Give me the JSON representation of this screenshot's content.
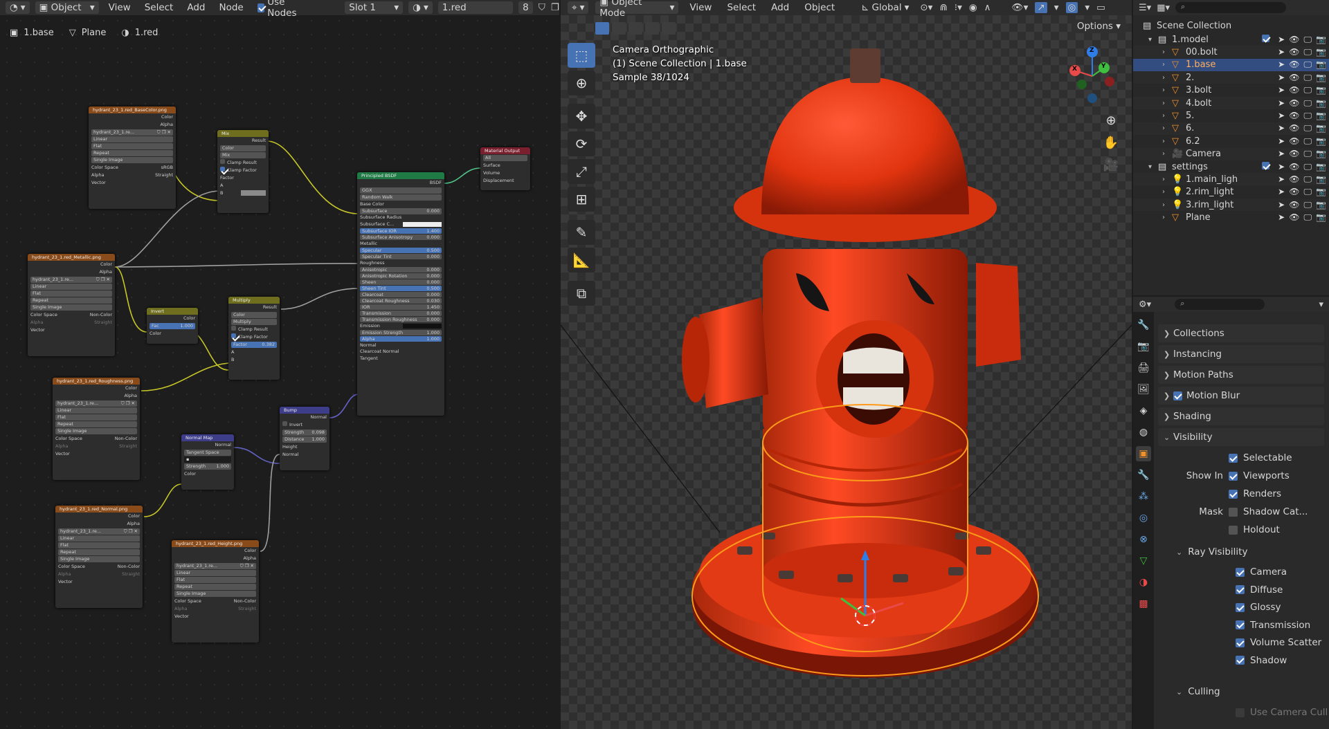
{
  "node_editor": {
    "header": {
      "mode": "Object",
      "menus": [
        "View",
        "Select",
        "Add",
        "Node"
      ],
      "use_nodes_label": "Use Nodes",
      "slot": "Slot 1",
      "material": "1.red",
      "users": "8"
    },
    "breadcrumb": {
      "object": "1.base",
      "mesh": "Plane",
      "material": "1.red"
    },
    "nodes": {
      "basecolor": {
        "title": "hydrant_23_1.red_BaseColor.png",
        "image": "hydrant_23_1.re...",
        "interp": "Linear",
        "proj": "Flat",
        "ext": "Repeat",
        "src": "Single Image",
        "cs_label": "Color Space",
        "cs": "sRGB",
        "alpha_label": "Alpha",
        "alpha": "Straight"
      },
      "metallic": {
        "title": "hydrant_23_1.red_Metallic.png",
        "image": "hydrant_23_1.re...",
        "interp": "Linear",
        "proj": "Flat",
        "ext": "Repeat",
        "src": "Single Image",
        "cs_label": "Color Space",
        "cs": "Non-Color",
        "alpha_label": "Alpha",
        "alpha": "Straight"
      },
      "roughness": {
        "title": "hydrant_23_1.red_Roughness.png",
        "image": "hydrant_23_1.re...",
        "interp": "Linear",
        "proj": "Flat",
        "ext": "Repeat",
        "src": "Single Image",
        "cs_label": "Color Space",
        "cs": "Non-Color",
        "alpha_label": "Alpha",
        "alpha": "Straight"
      },
      "normal": {
        "title": "hydrant_23_1.red_Normal.png",
        "image": "hydrant_23_1.re...",
        "interp": "Linear",
        "proj": "Flat",
        "ext": "Repeat",
        "src": "Single Image",
        "cs_label": "Color Space",
        "cs": "Non-Color",
        "alpha_label": "Alpha",
        "alpha": "Straight"
      },
      "height": {
        "title": "hydrant_23_1.red_Height.png",
        "image": "hydrant_23_1.re...",
        "interp": "Linear",
        "proj": "Flat",
        "ext": "Repeat",
        "src": "Single Image",
        "cs_label": "Color Space",
        "cs": "Non-Color",
        "alpha_label": "Alpha",
        "alpha": "Straight"
      },
      "mix": {
        "title": "Mix",
        "result": "Result",
        "type": "Color",
        "blend": "Mix",
        "clamp_result": "Clamp Result",
        "clamp_factor": "Clamp Factor",
        "factor": "Factor",
        "a": "A",
        "b": "B"
      },
      "invert": {
        "title": "Invert",
        "color": "Color",
        "fac": "Fac",
        "fac_val": "1.000"
      },
      "multiply": {
        "title": "Multiply",
        "result": "Result",
        "type": "Color",
        "blend": "Multiply",
        "clamp_result": "Clamp Result",
        "clamp_factor": "Clamp Factor",
        "factor": "Factor",
        "factor_val": "0.382",
        "a": "A",
        "b": "B"
      },
      "normal_map": {
        "title": "Normal Map",
        "out": "Normal",
        "space": "Tangent Space",
        "strength": "Strength",
        "strength_val": "1.000",
        "color": "Color"
      },
      "bump": {
        "title": "Bump",
        "out": "Normal",
        "invert": "Invert",
        "strength": "Strength",
        "strength_val": "0.098",
        "distance": "Distance",
        "distance_val": "1.000",
        "height": "Height",
        "normal": "Normal"
      },
      "bsdf": {
        "title": "Principled BSDF",
        "out": "BSDF",
        "dist": "GGX",
        "sss": "Random Walk",
        "rows": [
          [
            "Base Color",
            ""
          ],
          [
            "Subsurface",
            "0.000"
          ],
          [
            "Subsurface Radius",
            ""
          ],
          [
            "Subsurface C...",
            ""
          ],
          [
            "Subsurface IOR",
            "1.400"
          ],
          [
            "Subsurface Anisotropy",
            "0.000"
          ],
          [
            "Metallic",
            ""
          ],
          [
            "Specular",
            "0.500"
          ],
          [
            "Specular Tint",
            "0.000"
          ],
          [
            "Roughness",
            ""
          ],
          [
            "Anisotropic",
            "0.000"
          ],
          [
            "Anisotropic Rotation",
            "0.000"
          ],
          [
            "Sheen",
            "0.000"
          ],
          [
            "Sheen Tint",
            "0.500"
          ],
          [
            "Clearcoat",
            "0.000"
          ],
          [
            "Clearcoat Roughness",
            "0.030"
          ],
          [
            "IOR",
            "1.450"
          ],
          [
            "Transmission",
            "0.000"
          ],
          [
            "Transmission Roughness",
            "0.000"
          ],
          [
            "Emission",
            ""
          ],
          [
            "Emission Strength",
            "1.000"
          ],
          [
            "Alpha",
            "1.000"
          ],
          [
            "Normal",
            ""
          ],
          [
            "Clearcoat Normal",
            ""
          ],
          [
            "Tangent",
            ""
          ]
        ]
      },
      "output": {
        "title": "Material Output",
        "target": "All",
        "surface": "Surface",
        "volume": "Volume",
        "displacement": "Displacement"
      },
      "sockets": {
        "color": "Color",
        "alpha": "Alpha",
        "vector": "Vector"
      }
    }
  },
  "viewport": {
    "header": {
      "mode": "Object Mode",
      "menus": [
        "View",
        "Select",
        "Add",
        "Object"
      ],
      "transform": "Global"
    },
    "options": "Options",
    "info": {
      "line1": "Camera Orthographic",
      "line2": "(1) Scene Collection | 1.base",
      "line3": "Sample 38/1024"
    },
    "gizmo": {
      "x": "X",
      "y": "Y",
      "z": "Z"
    }
  },
  "outliner": {
    "root": "Scene Collection",
    "rows": [
      {
        "name": "1.model",
        "type": "collection"
      },
      {
        "name": "00.bolt",
        "type": "object"
      },
      {
        "name": "1.base",
        "type": "object"
      },
      {
        "name": "2.",
        "type": "object"
      },
      {
        "name": "3.bolt",
        "type": "object"
      },
      {
        "name": "4.bolt",
        "type": "object"
      },
      {
        "name": "5.",
        "type": "object"
      },
      {
        "name": "6.",
        "type": "object"
      },
      {
        "name": "6.2",
        "type": "object"
      },
      {
        "name": "Camera",
        "type": "camera"
      },
      {
        "name": "settings",
        "type": "collection"
      },
      {
        "name": "1.main_ligh",
        "type": "light"
      },
      {
        "name": "2.rim_light",
        "type": "light"
      },
      {
        "name": "3.rim_light",
        "type": "light"
      },
      {
        "name": "Plane",
        "type": "object"
      }
    ]
  },
  "properties": {
    "panels": {
      "collections": "Collections",
      "instancing": "Instancing",
      "motion_paths": "Motion Paths",
      "motion_blur": "Motion Blur",
      "shading": "Shading",
      "visibility": "Visibility",
      "ray_visibility": "Ray Visibility",
      "culling": "Culling"
    },
    "visibility": {
      "selectable": "Selectable",
      "show_in": "Show In",
      "viewports": "Viewports",
      "renders": "Renders",
      "mask": "Mask",
      "shadow_catcher": "Shadow Cat...",
      "holdout": "Holdout"
    },
    "ray": [
      "Camera",
      "Diffuse",
      "Glossy",
      "Transmission",
      "Volume Scatter",
      "Shadow"
    ],
    "culling_camera": "Use Camera Cull"
  }
}
